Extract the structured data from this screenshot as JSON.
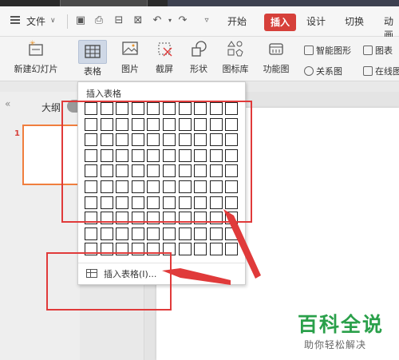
{
  "menubar": {
    "file_label": "文件",
    "tabs": [
      {
        "label": "开始"
      },
      {
        "label": "插入"
      },
      {
        "label": "设计"
      },
      {
        "label": "切换"
      },
      {
        "label": "动画"
      }
    ]
  },
  "ribbon": {
    "new_slide": "新建幻灯片",
    "table": "表格",
    "picture": "图片",
    "screenshot": "截屏",
    "shape": "形状",
    "icon_lib": "图标库",
    "function_chart": "功能图",
    "smart_graphic": "智能图形",
    "chart": "图表",
    "relation_chart": "关系图",
    "online": "在线图"
  },
  "left_panel": {
    "outline_label": "大纲",
    "slide_number": "1"
  },
  "dropdown": {
    "title": "插入表格",
    "insert_table_item": "插入表格(I)...",
    "grid_rows": 10,
    "grid_cols": 10
  },
  "watermark": {
    "title": "百科全说",
    "subtitle": "助你轻松解决"
  },
  "colors": {
    "accent_red": "#d6403a",
    "annotation_red": "#e03a3a",
    "watermark_green": "#2aa04a"
  }
}
